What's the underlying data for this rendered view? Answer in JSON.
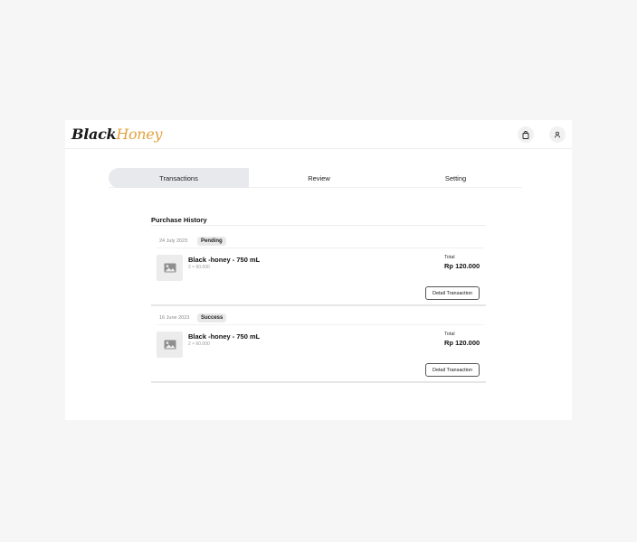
{
  "brand": {
    "part1": "Black",
    "part2": "Honey"
  },
  "header_icons": [
    "shopping-bag-icon",
    "user-icon"
  ],
  "tabs": [
    {
      "label": "Transactions",
      "active": true
    },
    {
      "label": "Review",
      "active": false
    },
    {
      "label": "Setting",
      "active": false
    }
  ],
  "purchase_history": {
    "title": "Purchase History",
    "orders": [
      {
        "date": "24 July 2023",
        "status": "Pending",
        "product": "Black -honey - 750 mL",
        "quantity": "2 × 60.000",
        "total_label": "Total",
        "total": "Rp 120.000",
        "button": "Detail Transaction"
      },
      {
        "date": "16 June 2023",
        "status": "Success",
        "product": "Black -honey - 750 mL",
        "quantity": "2 × 60.000",
        "total_label": "Total",
        "total": "Rp 120.000",
        "button": "Detail Transaction"
      }
    ]
  },
  "colors": {
    "brand_accent": "#e3a23d",
    "active_tab": "#e8e9ed"
  }
}
